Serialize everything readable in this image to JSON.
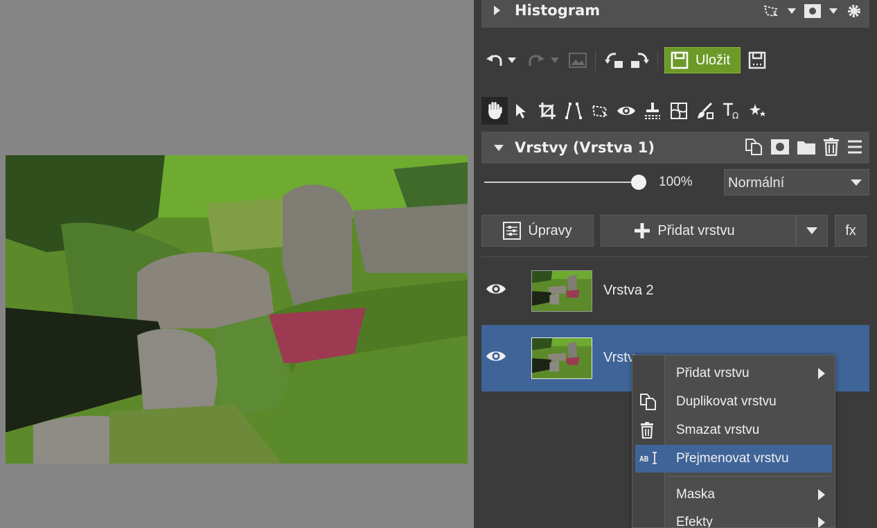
{
  "histogram": {
    "title": "Histogram",
    "icons": [
      "selection-icon",
      "caret-icon",
      "mask-icon",
      "caret-icon",
      "settings-icon"
    ]
  },
  "toolbar": {
    "save_label": "Uložit",
    "icons": [
      "undo-icon",
      "undo-history-icon",
      "redo-icon",
      "redo-history-icon",
      "image-icon",
      "rotate-left-icon",
      "rotate-right-icon",
      "save-icon",
      "save-as-icon"
    ]
  },
  "tools": [
    "hand-icon",
    "pointer-icon",
    "crop-icon",
    "perspective-icon",
    "transform-icon",
    "eye-icon",
    "clone-icon",
    "mesh-icon",
    "brush-icon",
    "text-icon",
    "effects-icon"
  ],
  "layers": {
    "title": "Vrstvy (Vrstva 1)",
    "header_icons": [
      "duplicate-icon",
      "mask-icon",
      "folder-icon",
      "trash-icon",
      "menu-icon"
    ],
    "opacity": "100%",
    "opacity_fraction": 1.0,
    "blend_mode": "Normální",
    "adjust_label": "Úpravy",
    "add_layer_label": "Přidat vrstvu",
    "fx_label": "fx",
    "items": [
      {
        "name": "Vrstva 2",
        "selected": false
      },
      {
        "name": "Vrstva 1",
        "visible_name": "Vrstv",
        "selected": true
      }
    ]
  },
  "context_menu": {
    "items": [
      {
        "label": "Přidat vrstvu",
        "icon": "",
        "submenu": true
      },
      {
        "label": "Duplikovat vrstvu",
        "icon": "duplicate-icon",
        "submenu": false
      },
      {
        "label": "Smazat vrstvu",
        "icon": "trash-icon",
        "submenu": false
      },
      {
        "label": "Přejmenovat vrstvu",
        "icon": "rename-icon",
        "submenu": false,
        "highlighted": true
      },
      {
        "label": "Maska",
        "icon": "",
        "submenu": true
      },
      {
        "label": "Efekty",
        "icon": "",
        "submenu": true
      }
    ]
  },
  "colors": {
    "accent": "#3f6498",
    "save": "#6c9a28",
    "panel": "#3b3b3b",
    "canvas": "#858585"
  }
}
